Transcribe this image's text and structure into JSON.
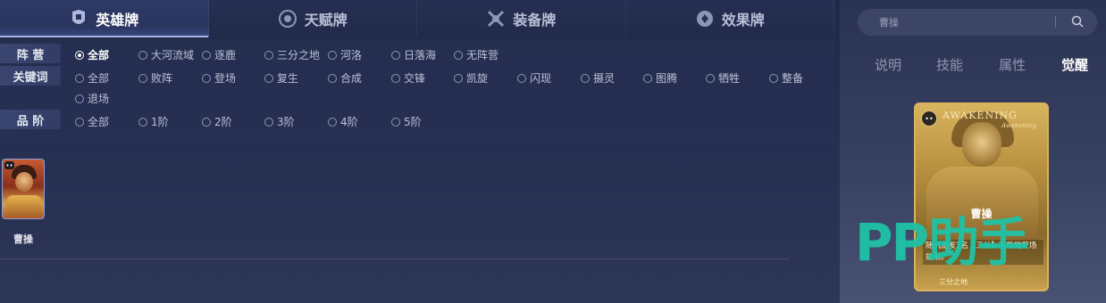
{
  "tabs": [
    {
      "label": "英雄牌",
      "icon": "hero-icon",
      "active": true
    },
    {
      "label": "天赋牌",
      "icon": "talent-icon",
      "active": false
    },
    {
      "label": "装备牌",
      "icon": "equipment-icon",
      "active": false
    },
    {
      "label": "效果牌",
      "icon": "effect-icon",
      "active": false
    }
  ],
  "filters": {
    "camp": {
      "label": "阵 营",
      "options": [
        "全部",
        "大河流域",
        "逐鹿",
        "三分之地",
        "河洛",
        "日落海",
        "无阵营"
      ],
      "selected": "全部"
    },
    "keyword": {
      "label": "关键词",
      "options": [
        "全部",
        "败阵",
        "登场",
        "复生",
        "合成",
        "交锋",
        "凯旋",
        "闪现",
        "摄灵",
        "图腾",
        "牺牲",
        "整备",
        "退场"
      ]
    },
    "rank": {
      "label": "品 阶",
      "options": [
        "全部",
        "1阶",
        "2阶",
        "3阶",
        "4阶",
        "5阶"
      ]
    }
  },
  "cards": [
    {
      "name": "曹操",
      "badge": "••"
    }
  ],
  "search": {
    "placeholder": "曹操"
  },
  "detail_tabs": [
    {
      "label": "说明",
      "active": false
    },
    {
      "label": "技能",
      "active": false
    },
    {
      "label": "属性",
      "active": false
    },
    {
      "label": "觉醒",
      "active": true
    }
  ],
  "detail_card": {
    "title_text": "AWAKENING",
    "subtitle_text": "Awakening",
    "badge": "••",
    "name": "曹操",
    "description": "随机激发2名【三分】英雄的登场效果。",
    "footer": "三分之地"
  },
  "watermark": "PP助手",
  "colors": {
    "accent": "#ffffff",
    "watermark": "#1fc3a6",
    "gold": "#d9b35a"
  }
}
